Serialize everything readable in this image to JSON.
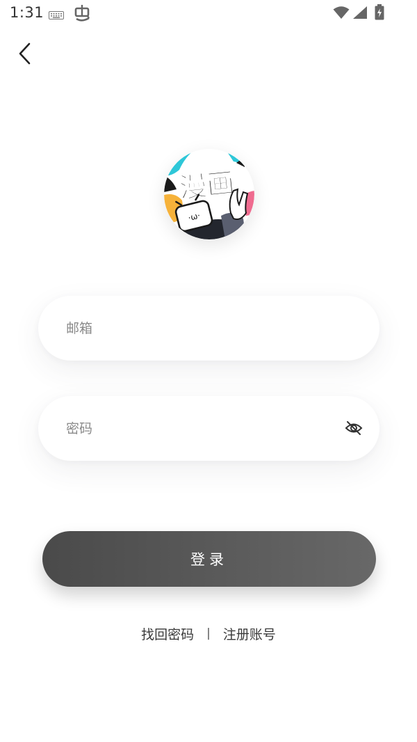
{
  "status_bar": {
    "time": "1:31",
    "icons": [
      "keyboard-icon",
      "bug-icon",
      "wifi-icon",
      "signal-icon",
      "battery-icon"
    ]
  },
  "nav": {
    "back_icon": "chevron-left-icon"
  },
  "logo": {
    "text": "漫画",
    "face_text": "·ω·",
    "colors": {
      "cyan": "#2ec7d8",
      "orange": "#f6b23a",
      "pink": "#ef6b8f",
      "ink": "#1a1a1a"
    }
  },
  "form": {
    "email_placeholder": "邮箱",
    "email_value": "",
    "password_placeholder": "密码",
    "password_value": "",
    "password_toggle_icon": "eye-off-icon"
  },
  "login_label": "登录",
  "links": {
    "forgot": "找回密码",
    "separator": "|",
    "register": "注册账号"
  }
}
